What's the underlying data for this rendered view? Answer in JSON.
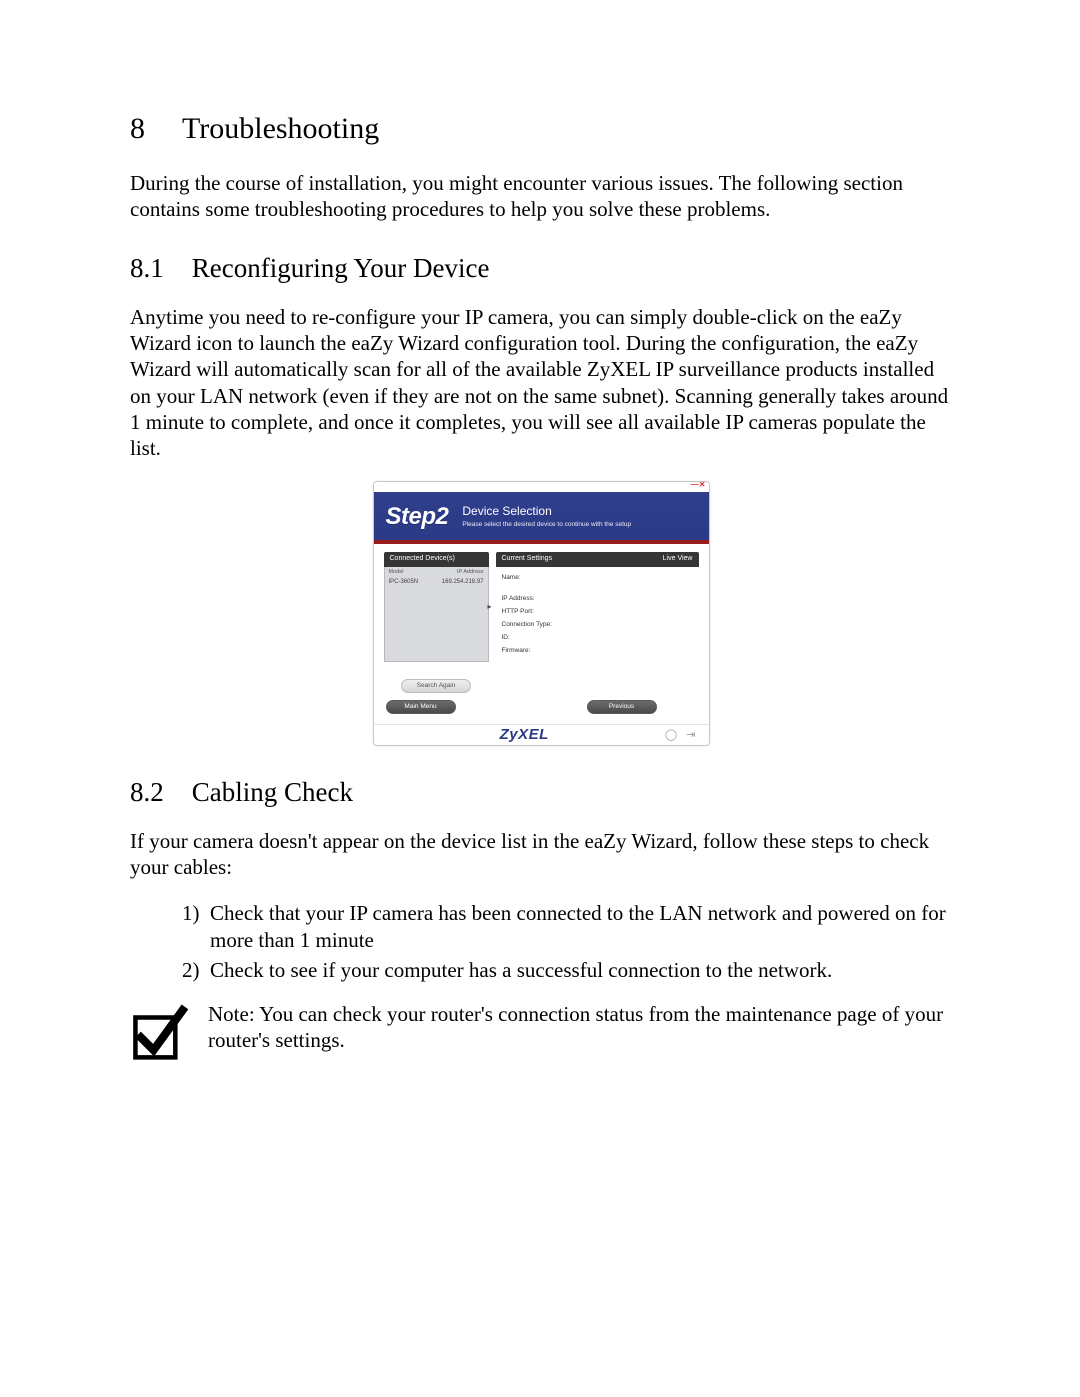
{
  "section": {
    "number": "8",
    "title": "Troubleshooting",
    "intro": "During the course of installation, you might encounter various issues. The following section contains some troubleshooting procedures to help you solve these problems."
  },
  "sub1": {
    "number": "8.1",
    "title": "Reconfiguring Your Device",
    "body": "Anytime you need to re-configure your IP camera, you can simply double-click on the eaZy Wizard icon to launch the eaZy Wizard configuration tool. During the configuration, the eaZy Wizard will automatically scan for all of the available ZyXEL IP surveillance products installed on your LAN network (even if they are not on the same subnet). Scanning generally takes around 1 minute to complete, and once it completes, you will see all available IP cameras populate the list."
  },
  "wizard": {
    "step_label": "Step2",
    "title": "Device Selection",
    "subtitle": "Please select the desired device to continue with the setup",
    "left_header": "Connected Device(s)",
    "list_head_model": "Model",
    "list_head_ip": "IP Address",
    "list_row_model": "IPC-3605N",
    "list_row_ip": "169.254.218.97",
    "right_header": "Current Settings",
    "right_header_live": "Live View",
    "field_name": "Name:",
    "field_ip": "IP Address:",
    "field_http": "HTTP Port:",
    "field_conn": "Connection Type:",
    "field_id": "ID:",
    "field_fw": "Firmware:",
    "btn_search": "Search Again",
    "btn_main": "Main Menu",
    "btn_prev": "Previous",
    "brand": "ZyXEL"
  },
  "sub2": {
    "number": "8.2",
    "title": "Cabling Check",
    "body": "If your camera doesn't appear on the device list in the eaZy Wizard, follow these steps to check  your cables:",
    "steps": [
      "Check that your IP camera has been connected to the LAN network and powered on for more than 1 minute",
      "Check to see if your computer has a successful connection to the network."
    ],
    "note": "Note: You can check your router's connection status from the maintenance page of your router's settings."
  }
}
